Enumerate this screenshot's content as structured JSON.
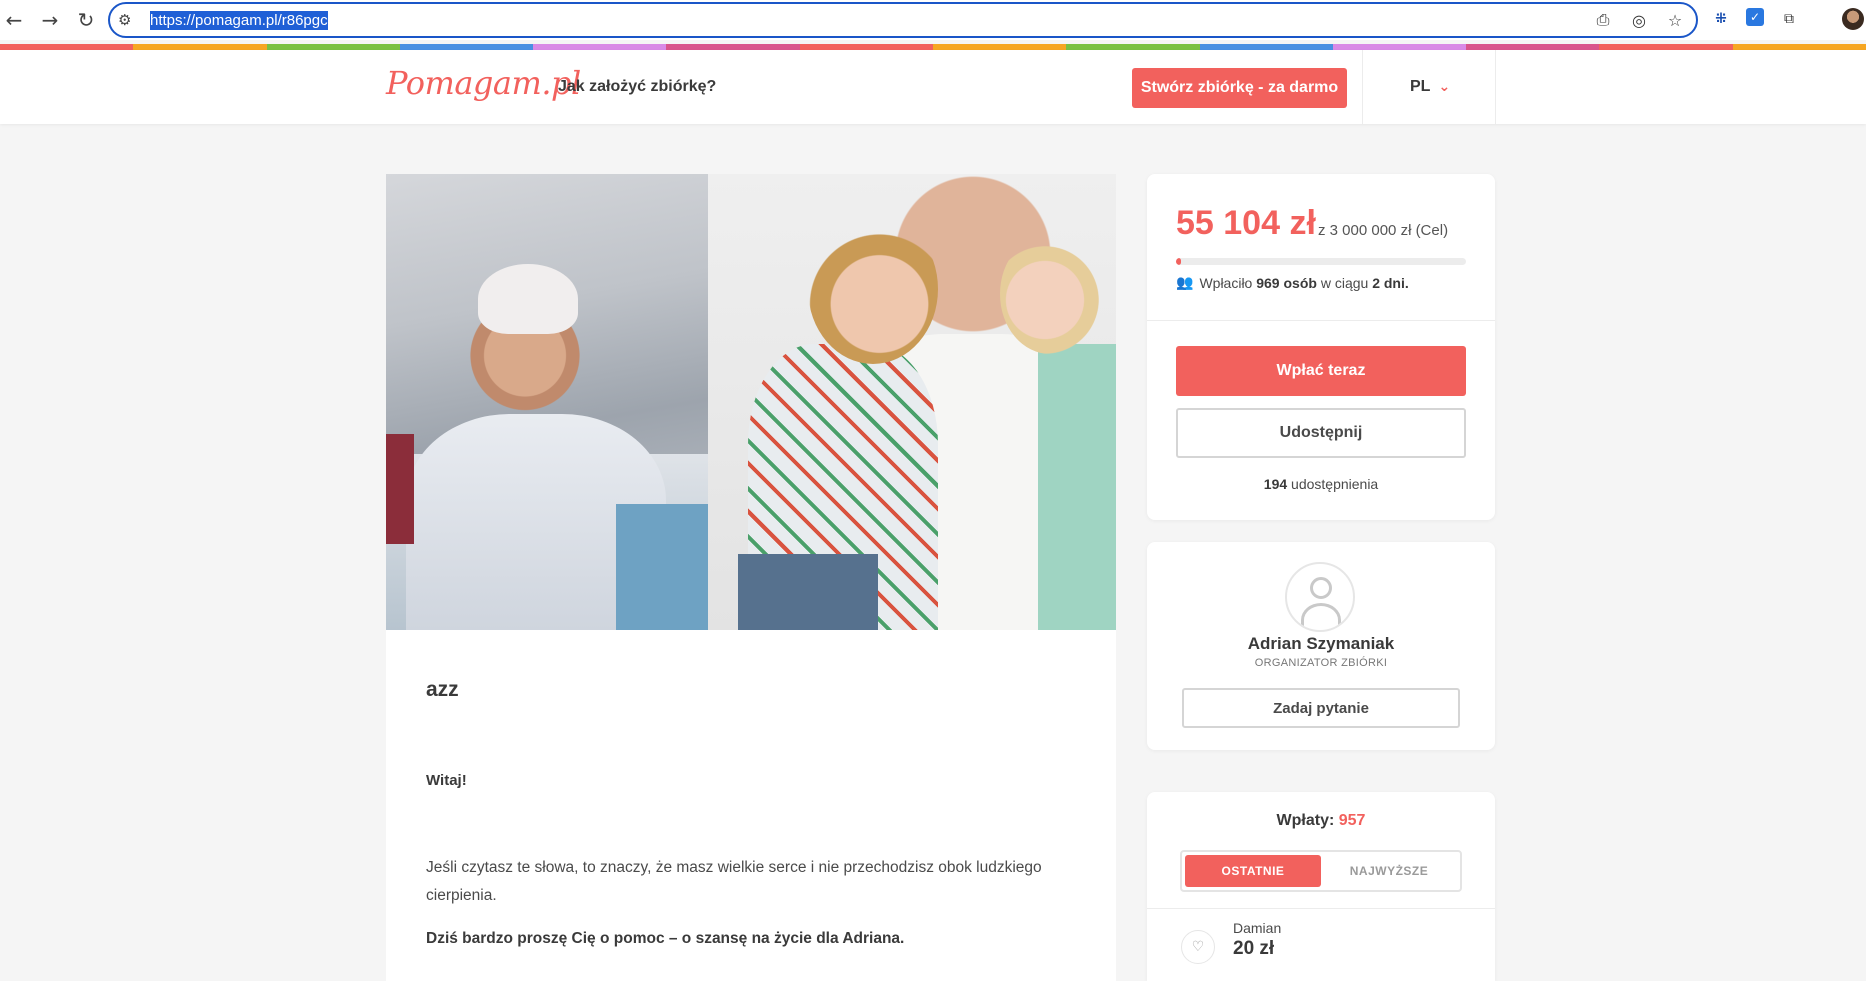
{
  "browser": {
    "url": "https://pomagam.pl/r86pgc",
    "icons": [
      "back-arrow-icon",
      "forward-arrow-icon",
      "reload-icon",
      "site-settings-icon",
      "install-app-icon",
      "eye-off-icon",
      "star-icon",
      "extension-icon",
      "checkbox-extension-icon",
      "puzzle-icon",
      "profile-avatar"
    ]
  },
  "rainbow": [
    "#f2615d",
    "#f6a623",
    "#7ac142",
    "#4a90e2",
    "#d98ae6",
    "#d9558c",
    "#f2615d",
    "#f6a623",
    "#7ac142",
    "#4a90e2",
    "#d98ae6",
    "#d9558c",
    "#f2615d",
    "#f6a623"
  ],
  "header": {
    "logo": "Pomagam.pl",
    "how_link": "Jak założyć zbiórkę?",
    "create_button": "Stwórz zbiórkę - za darmo",
    "language": "PL"
  },
  "story": {
    "title": "azz",
    "greeting": "Witaj!",
    "paragraph1": "Jeśli czytasz te słowa, to znaczy, że masz wielkie serce i nie przechodzisz obok ludzkiego cierpienia.",
    "paragraph2": "Dziś bardzo proszę Cię o pomoc – o szansę na życie dla Adriana."
  },
  "campaign": {
    "amount": "55 104 zł",
    "goal": "z 3 000 000 zł (Cel)",
    "progress": 0.018,
    "donors_prefix": "Wpłaciło ",
    "donors_count": "969 osób",
    "donors_mid": " w ciągu ",
    "donors_days": "2 dni.",
    "pay_button": "Wpłać teraz",
    "share_button": "Udostępnij",
    "share_count": "194",
    "share_suffix": " udostępnienia"
  },
  "organizer": {
    "name": "Adrian Szymaniak",
    "role": "ORGANIZATOR ZBIÓRKI",
    "ask_button": "Zadaj pytanie"
  },
  "payments": {
    "title": "Wpłaty: ",
    "count": "957",
    "tabs": [
      "OSTATNIE",
      "NAJWYŻSZE"
    ],
    "items": [
      {
        "name": "Damian",
        "amount": "20 zł"
      }
    ]
  },
  "colors": {
    "accent": "#f2615d",
    "text": "#3a3a3a",
    "background": "#f5f5f5"
  }
}
